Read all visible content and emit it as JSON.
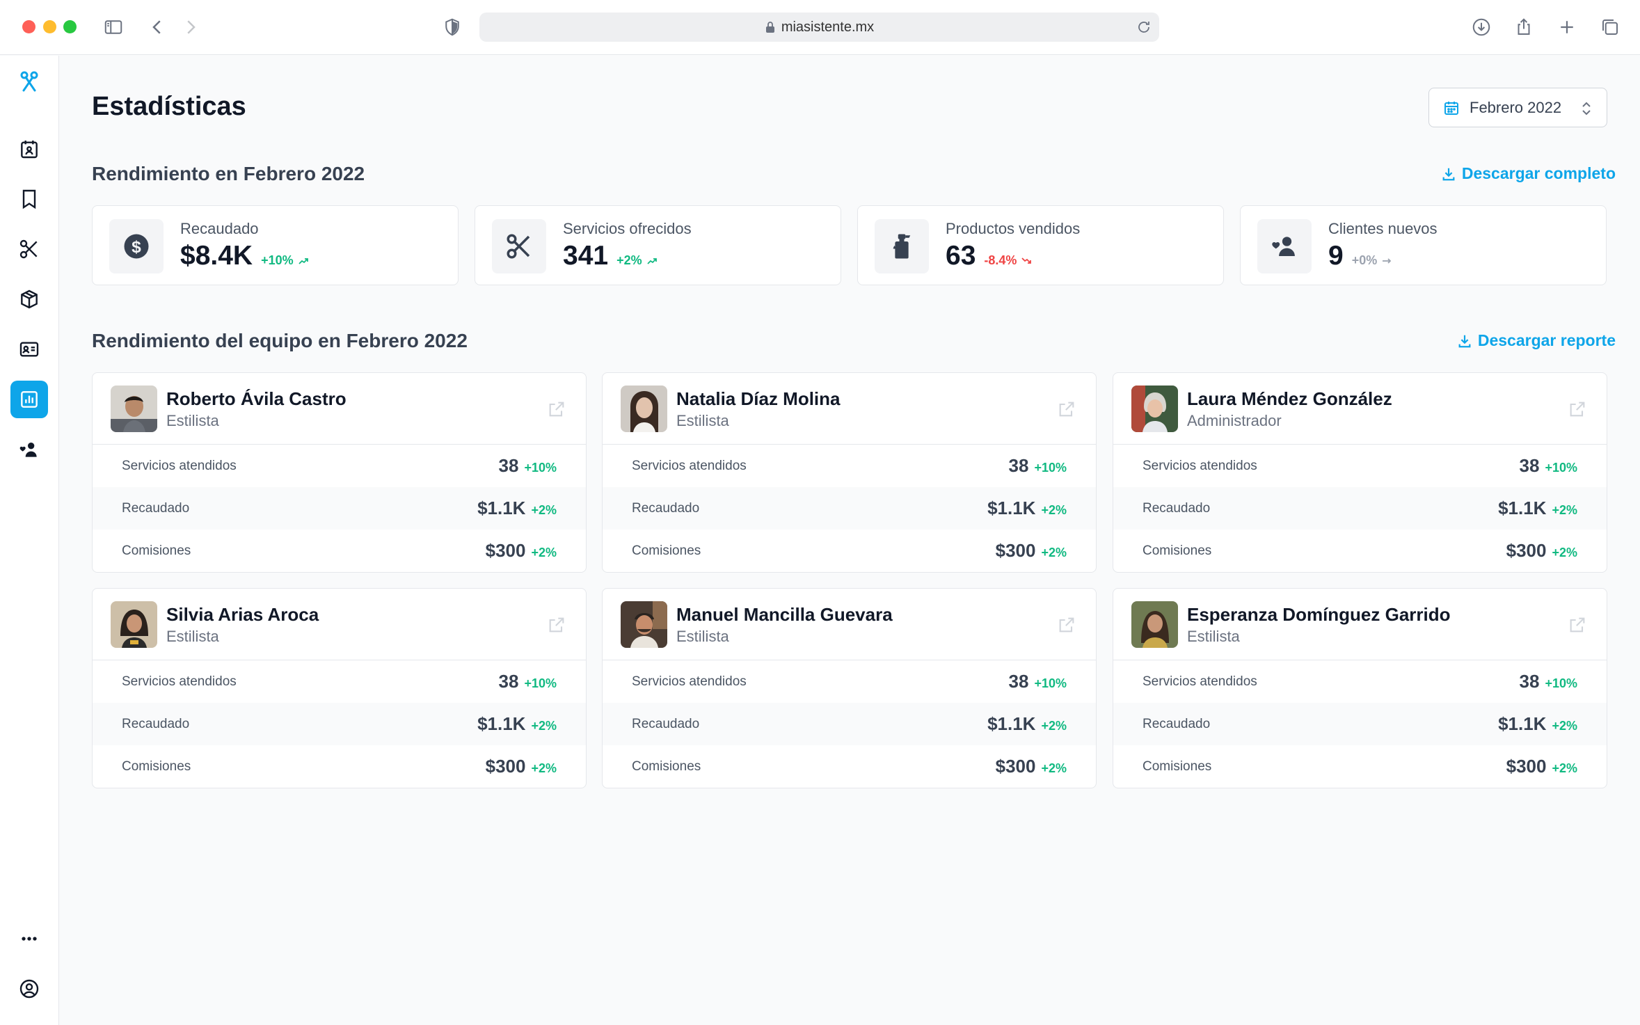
{
  "browser": {
    "url": "miasistente.mx"
  },
  "page": {
    "title": "Estadísticas",
    "month_selector": "Febrero 2022"
  },
  "performance": {
    "title": "Rendimiento en Febrero 2022",
    "download_label": "Descargar completo",
    "stats": [
      {
        "label": "Recaudado",
        "value": "$8.4K",
        "delta": "+10%",
        "trend": "up",
        "icon": "dollar-icon"
      },
      {
        "label": "Servicios ofrecidos",
        "value": "341",
        "delta": "+2%",
        "trend": "up",
        "icon": "scissors-icon"
      },
      {
        "label": "Productos vendidos",
        "value": "63",
        "delta": "-8.4%",
        "trend": "down",
        "icon": "spray-bottle-icon"
      },
      {
        "label": "Clientes nuevos",
        "value": "9",
        "delta": "+0%",
        "trend": "flat",
        "icon": "user-heart-icon"
      }
    ]
  },
  "team": {
    "title": "Rendimiento del equipo en Febrero 2022",
    "download_label": "Descargar reporte",
    "row_labels": {
      "services": "Servicios atendidos",
      "collected": "Recaudado",
      "commissions": "Comisiones"
    },
    "members": [
      {
        "name": "Roberto Ávila Castro",
        "role": "Estilista",
        "services": "38",
        "services_delta": "+10%",
        "collected": "$1.1K",
        "collected_delta": "+2%",
        "commissions": "$300",
        "commissions_delta": "+2%"
      },
      {
        "name": "Natalia Díaz Molina",
        "role": "Estilista",
        "services": "38",
        "services_delta": "+10%",
        "collected": "$1.1K",
        "collected_delta": "+2%",
        "commissions": "$300",
        "commissions_delta": "+2%"
      },
      {
        "name": "Laura Méndez González",
        "role": "Administrador",
        "services": "38",
        "services_delta": "+10%",
        "collected": "$1.1K",
        "collected_delta": "+2%",
        "commissions": "$300",
        "commissions_delta": "+2%"
      },
      {
        "name": "Silvia Arias Aroca",
        "role": "Estilista",
        "services": "38",
        "services_delta": "+10%",
        "collected": "$1.1K",
        "collected_delta": "+2%",
        "commissions": "$300",
        "commissions_delta": "+2%"
      },
      {
        "name": "Manuel Mancilla Guevara",
        "role": "Estilista",
        "services": "38",
        "services_delta": "+10%",
        "collected": "$1.1K",
        "collected_delta": "+2%",
        "commissions": "$300",
        "commissions_delta": "+2%"
      },
      {
        "name": "Esperanza Domínguez Garrido",
        "role": "Estilista",
        "services": "38",
        "services_delta": "+10%",
        "collected": "$1.1K",
        "collected_delta": "+2%",
        "commissions": "$300",
        "commissions_delta": "+2%"
      }
    ]
  },
  "colors": {
    "accent": "#0ea5e9",
    "positive": "#10b981",
    "negative": "#ef4444",
    "neutral": "#9ca3af"
  }
}
